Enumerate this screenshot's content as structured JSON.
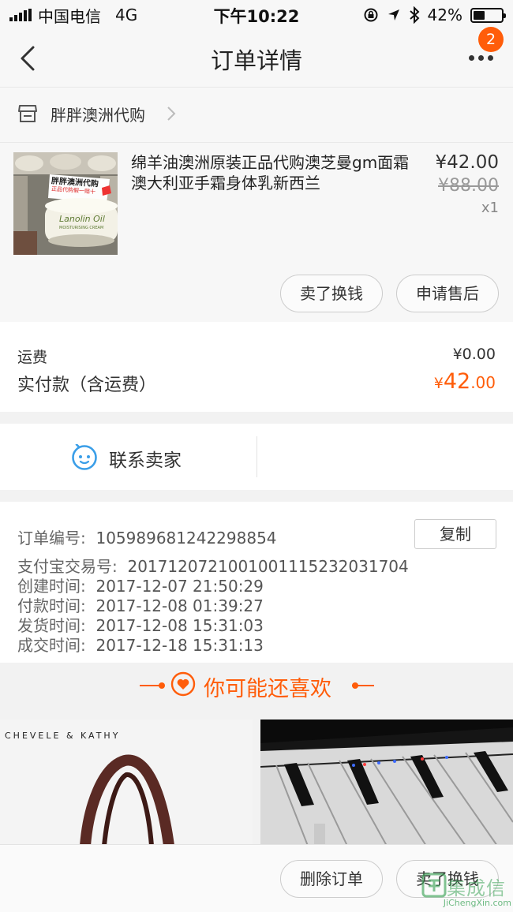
{
  "status_bar": {
    "carrier": "中国电信",
    "network": "4G",
    "time": "下午10:22",
    "battery": "42%",
    "battery_level": 0.42
  },
  "nav": {
    "title": "订单详情",
    "badge_count": "2"
  },
  "shop": {
    "name": "胖胖澳洲代购"
  },
  "product": {
    "title": "绵羊油澳洲原装正品代购澳芝曼gm面霜澳大利亚手霜身体乳新西兰",
    "price": "¥42.00",
    "original_price": "¥88.00",
    "quantity": "x1",
    "image_texts": {
      "tag": "胖胖澳洲代购",
      "tag_sub": "正品代购假一赔十",
      "brand": "Lanolin Oil",
      "brand_sub": "MOISTURISING CREAM"
    },
    "buttons": {
      "sell": "卖了换钱",
      "after_sale": "申请售后"
    }
  },
  "fees": {
    "shipping_label": "运费",
    "shipping_value": "¥0.00",
    "paid_label": "实付款（含运费）",
    "paid_currency": "¥",
    "paid_integer": "42",
    "paid_decimal": ".00"
  },
  "contact": {
    "label": "联系卖家"
  },
  "order_info": {
    "order_no_label": "订单编号:",
    "order_no": "105989681242298854",
    "copy_button": "复制",
    "alipay_label": "支付宝交易号:",
    "alipay_no": "2017120721001001115232031704",
    "created_label": "创建时间:",
    "created": "2017-12-07 21:50:29",
    "paid_label": "付款时间:",
    "paid": "2017-12-08 01:39:27",
    "shipped_label": "发货时间:",
    "shipped": "2017-12-08 15:31:03",
    "completed_label": "成交时间:",
    "completed": "2017-12-18 15:31:13"
  },
  "recommend": {
    "title": "你可能还喜欢",
    "card1_brand": "CHEVELE & KATHY"
  },
  "bottom_bar": {
    "delete_button": "删除订单",
    "sell_button": "卖了换钱"
  },
  "watermark": {
    "text": "集成信",
    "sub": "JiChengXin.com"
  },
  "colors": {
    "accent": "#ff5d0a",
    "contact_icon": "#3a9ee8"
  }
}
